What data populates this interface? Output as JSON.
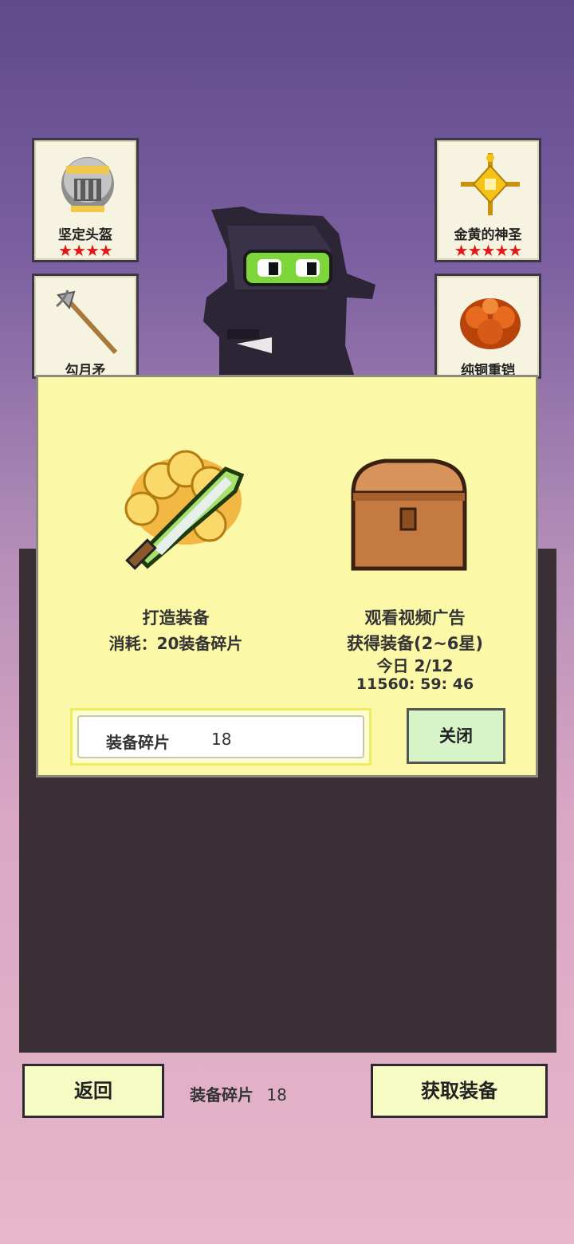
{
  "cards": [
    {
      "name": "坚定头盔",
      "stars": "★★★★"
    },
    {
      "name": "金黄的神圣",
      "stars": "★★★★★"
    },
    {
      "name": "勾月矛"
    },
    {
      "name": "纯铜重铠"
    }
  ],
  "popup": {
    "craft": {
      "title": "打造装备",
      "cost": "消耗：20装备碎片"
    },
    "ad": {
      "title": "观看视频广告",
      "reward": "获得装备(2~6星)",
      "today": "今日 2/12",
      "timer": "11560: 59: 46"
    },
    "fragment_label": "装备碎片",
    "fragment_count": "18",
    "close_label": "关闭"
  },
  "bottom": {
    "back_label": "返回",
    "fragment_label": "装备碎片",
    "fragment_count": "18",
    "get_label": "获取装备"
  },
  "colors": {
    "star": "#e01818",
    "popup_bg": "#fbf8a8",
    "close_btn": "#d6f4c8"
  }
}
